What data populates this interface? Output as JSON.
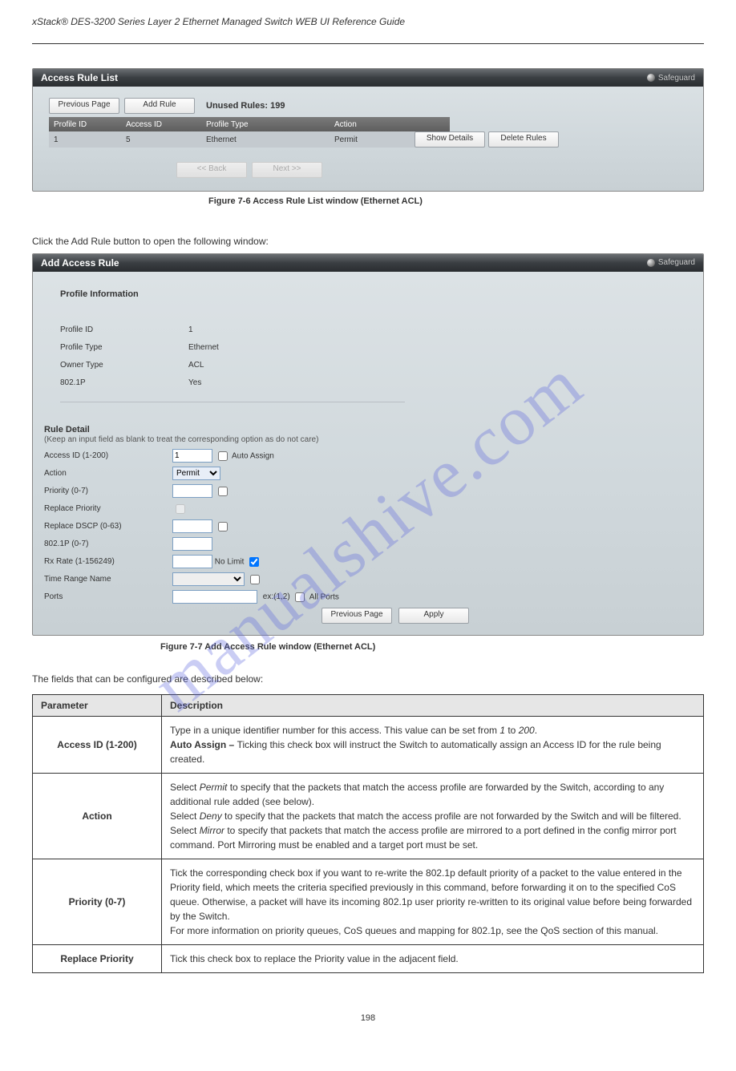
{
  "doc_title": "xStack® DES-3200 Series Layer 2 Ethernet Managed Switch WEB UI Reference Guide",
  "watermark": "manualshive.com",
  "page_number": "198",
  "panel1": {
    "title": "Access Rule List",
    "safeguard": "Safeguard",
    "buttons": {
      "prev": "Previous Page",
      "add": "Add Rule"
    },
    "unused_label": "Unused Rules:",
    "unused_value": "199",
    "columns": {
      "c1": "Profile ID",
      "c2": "Access ID",
      "c3": "Profile Type",
      "c4": "Action"
    },
    "row": {
      "c1": "1",
      "c2": "5",
      "c3": "Ethernet",
      "c4": "Permit",
      "show": "Show Details",
      "del": "Delete Rules"
    },
    "pager": {
      "back": "<< Back",
      "next": "Next >>"
    }
  },
  "caption1": "Figure 7-6 Access Rule List window (Ethernet ACL)",
  "mid_text": "Click the Add Rule button to open the following window:",
  "panel2": {
    "title": "Add Access Rule",
    "safeguard": "Safeguard",
    "section1": "Profile Information",
    "profile_id_label": "Profile ID",
    "profile_id_val": "1",
    "profile_type_label": "Profile Type",
    "profile_type_val": "Ethernet",
    "owner_type_label": "Owner Type",
    "owner_type_val": "ACL",
    "p8021_label": "802.1P",
    "p8021_val": "Yes",
    "section2": "Rule Detail",
    "rule_hint": "(Keep an input field as blank to treat the corresponding option as do not care)",
    "access_id_label": "Access ID (1-200)",
    "access_id_val": "1",
    "auto_assign": "Auto Assign",
    "action_label": "Action",
    "action_val": "Permit",
    "priority_label": "Priority  (0-7)",
    "replace_prio_label": "Replace Priority",
    "replace_dscp_label": "Replace DSCP  (0-63)",
    "p8021_rule_label": "802.1P  (0-7)",
    "rx_label": "Rx Rate  (1-156249)",
    "rx_nolimit": "No Limit",
    "time_label": "Time Range Name",
    "ports_label": "Ports",
    "ports_hint": "ex:(1,2)",
    "all_ports": "All Ports",
    "buttons": {
      "prev": "Previous Page",
      "apply": "Apply"
    }
  },
  "caption2": "Figure 7-7 Add Access Rule window (Ethernet ACL)",
  "intro": "The fields that can be configured are described below:",
  "table": {
    "h1": "Parameter",
    "h2": "Description",
    "r1p": "Access ID (1-200)",
    "r1d_a": "Type in a unique identifier number for this access. This value can be set from ",
    "r1d_b": "1",
    "r1d_c": " to ",
    "r1d_d": "200",
    "r1d_e": ".",
    "r1d_f": "Auto Assign – ",
    "r1d_g": "Ticking this check box will instruct the Switch to automatically assign an Access ID for the rule being created.",
    "r2p": "Action",
    "r2a": "Select ",
    "r2b": "Permit",
    "r2c": " to specify that the packets that match the access profile are forwarded by the Switch, according to any additional rule added (see below).",
    "r2d": "Select ",
    "r2e": "Deny",
    "r2f": " to specify that the packets that match the access profile are not forwarded by the Switch and will be filtered.",
    "r2g": "Select ",
    "r2h": "Mirror",
    "r2i": " to specify that packets that match the access profile are mirrored to a port defined in the config mirror port command. Port Mirroring must be enabled and a target port must be set.",
    "r3p": "Priority (0-7)",
    "r3a": "Tick the corresponding check box if you want to re-write the 802.1p default priority of a packet to the value entered in the Priority field, which meets the criteria specified previously in this command, before forwarding it on to the specified CoS queue. Otherwise, a packet will have its incoming 802.1p user priority re-written to its original value before being forwarded by the Switch.",
    "r3b": "For more information on priority queues, CoS queues and mapping for 802.1p, see the QoS section of this manual.",
    "r4p": "Replace Priority",
    "r4a": "Tick this check box to replace the Priority value in the adjacent field."
  }
}
